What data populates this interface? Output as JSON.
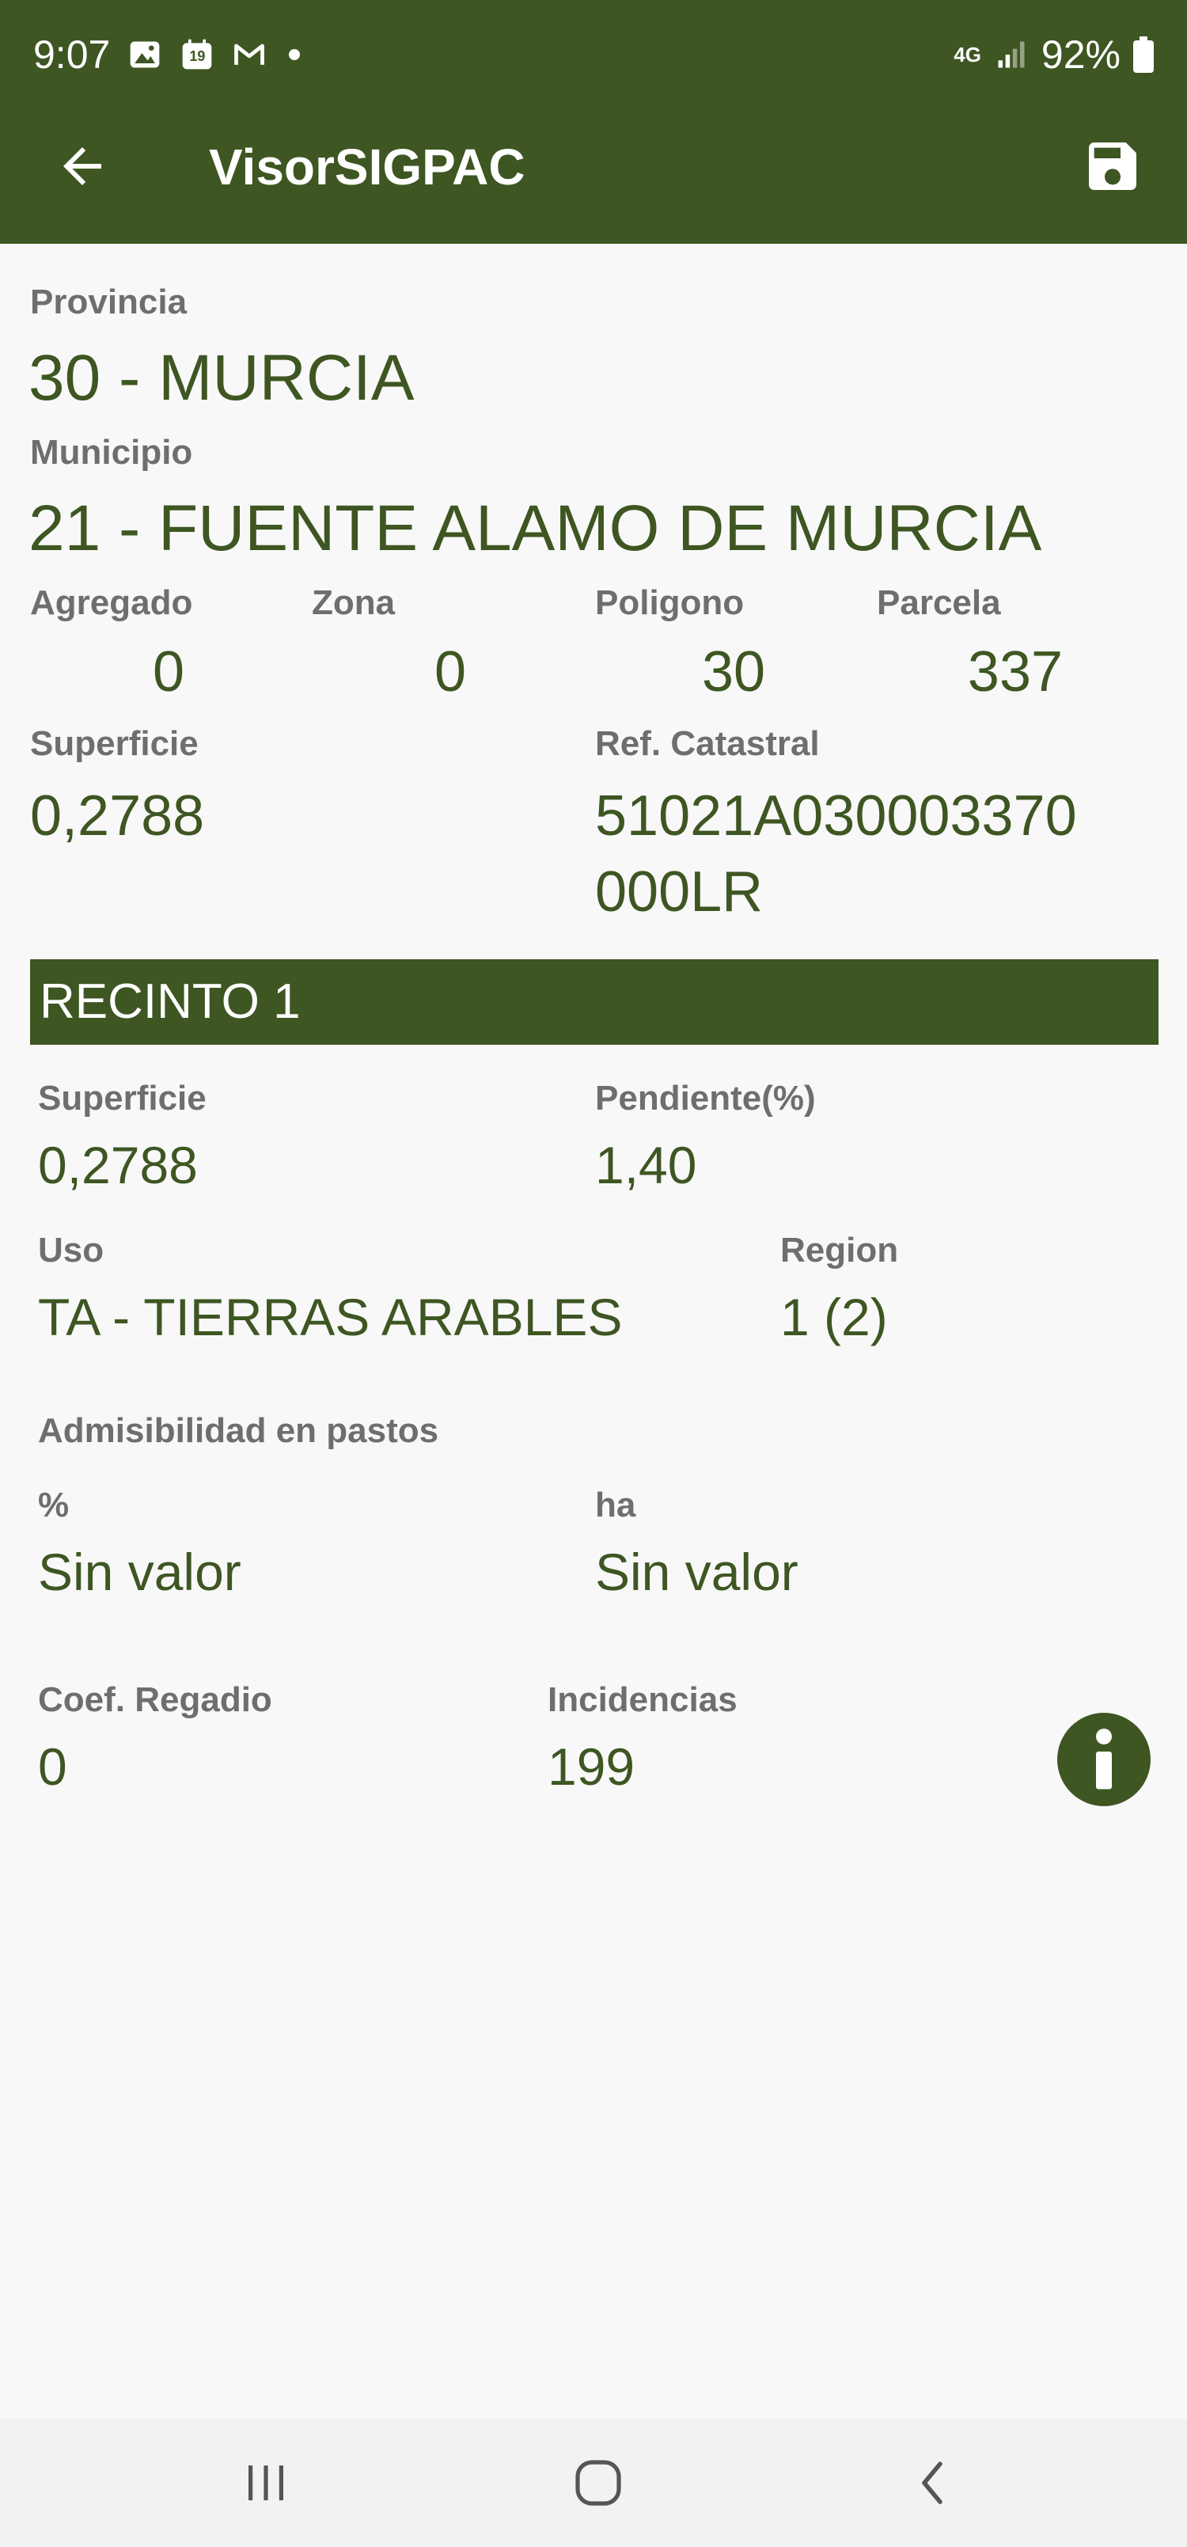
{
  "status_bar": {
    "time": "9:07",
    "calendar_day": "19",
    "network": "4G",
    "battery": "92%",
    "icons": [
      "image-icon",
      "calendar-icon",
      "gmail-icon",
      "notification-dot",
      "signal-icon",
      "battery-icon"
    ]
  },
  "app_bar": {
    "title": "VisorSIGPAC",
    "back_icon": "arrow-left-icon",
    "save_icon": "floppy-disk-icon"
  },
  "parcel": {
    "provincia_label": "Provincia",
    "provincia_value": "30 - MURCIA",
    "municipio_label": "Municipio",
    "municipio_value": "21 - FUENTE ALAMO DE MURCIA",
    "agregado_label": "Agregado",
    "agregado_value": "0",
    "zona_label": "Zona",
    "zona_value": "0",
    "poligono_label": "Poligono",
    "poligono_value": "30",
    "parcela_label": "Parcela",
    "parcela_value": "337",
    "superficie_label": "Superficie",
    "superficie_value": "0,2788",
    "ref_catastral_label": "Ref. Catastral",
    "ref_catastral_line1": "51021A030003370",
    "ref_catastral_line2": "000LR"
  },
  "recinto": {
    "header": "RECINTO 1",
    "superficie_label": "Superficie",
    "superficie_value": "0,2788",
    "pendiente_label": "Pendiente(%)",
    "pendiente_value": "1,40",
    "uso_label": "Uso",
    "uso_value": "TA - TIERRAS ARABLES",
    "region_label": "Region",
    "region_value": "1 (2)",
    "admisibilidad_label": "Admisibilidad en pastos",
    "pct_label": "%",
    "pct_value": "Sin valor",
    "ha_label": "ha",
    "ha_value": "Sin valor",
    "coef_regadio_label": "Coef. Regadio",
    "coef_regadio_value": "0",
    "incidencias_label": "Incidencias",
    "incidencias_value": "199",
    "info_icon": "info-icon"
  },
  "nav_bar": {
    "icons": [
      "recent-apps-icon",
      "home-icon",
      "back-icon"
    ]
  },
  "colors": {
    "primary": "#3e5622",
    "background": "#f8f8f8",
    "label": "#6e6e6e"
  }
}
